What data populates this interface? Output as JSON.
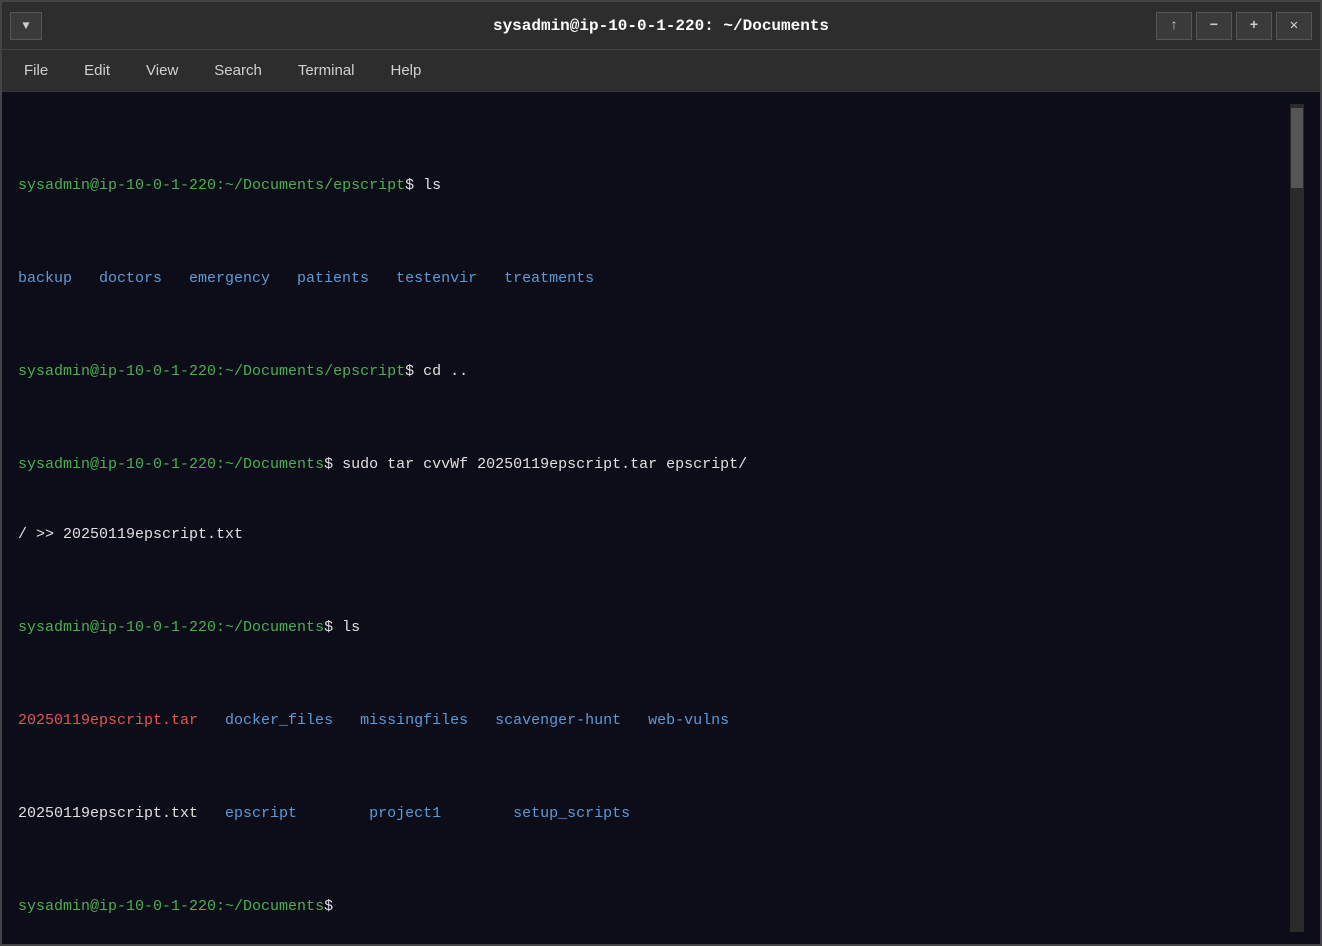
{
  "titlebar": {
    "title": "sysadmin@ip-10-0-1-220: ~/Documents",
    "dropdown_label": "▼",
    "btn_up": "↑",
    "btn_minus": "−",
    "btn_plus": "+",
    "btn_close": "✕"
  },
  "menubar": {
    "items": [
      "File",
      "Edit",
      "View",
      "Search",
      "Terminal",
      "Help"
    ]
  },
  "terminal": {
    "lines": [
      {
        "type": "prompt_cmd",
        "user": "sysadmin@ip-10-0-1-220",
        "path": ":~/Documents/epscript",
        "dollar": "$",
        "cmd": " ls"
      },
      {
        "type": "ls_output_blue",
        "content": "backup   doctors   emergency   patients   testenvir   treatments"
      },
      {
        "type": "prompt_cmd",
        "user": "sysadmin@ip-10-0-1-220",
        "path": ":~/Documents/epscript",
        "dollar": "$",
        "cmd": " cd .."
      },
      {
        "type": "prompt_cmd_wrap",
        "user": "sysadmin@ip-10-0-1-220",
        "path": ":~/Documents",
        "dollar": "$",
        "cmd": " sudo tar cvvWf 20250119epscript.tar epscript/",
        "wrap": "/ >> 20250119epscript.txt"
      },
      {
        "type": "prompt_cmd",
        "user": "sysadmin@ip-10-0-1-220",
        "path": ":~/Documents",
        "dollar": "$",
        "cmd": " ls"
      },
      {
        "type": "ls_mixed_1",
        "red": "20250119epscript.tar",
        "blue_items": [
          "docker_files",
          "missingfiles",
          "scavenger-hunt",
          "web-vulns"
        ]
      },
      {
        "type": "ls_mixed_2",
        "white": "20250119epscript.txt",
        "blue_items": [
          "epscript",
          "project1",
          "setup_scripts"
        ]
      },
      {
        "type": "prompt_only",
        "user": "sysadmin@ip-10-0-1-220",
        "path": ":~/Documents",
        "dollar": "$"
      }
    ]
  }
}
